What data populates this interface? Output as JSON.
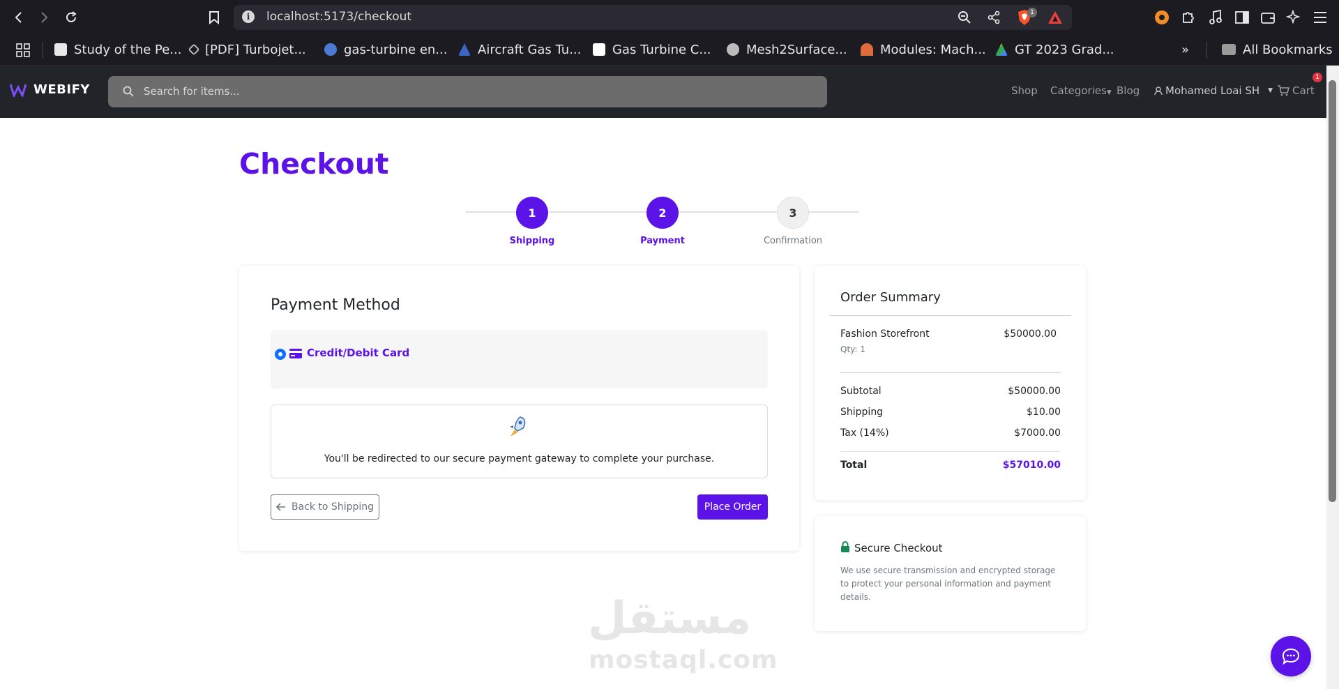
{
  "browser": {
    "url": "localhost:5173/checkout",
    "bookmarks": [
      {
        "label": "Study of the Pe..."
      },
      {
        "label": "[PDF] Turbojet..."
      },
      {
        "label": "gas-turbine en..."
      },
      {
        "label": "Aircraft Gas Tu..."
      },
      {
        "label": "Gas Turbine C..."
      },
      {
        "label": "Mesh2Surface..."
      },
      {
        "label": "Modules: Mach..."
      },
      {
        "label": "GT 2023 Grad..."
      }
    ],
    "bookmarks_more": "»",
    "all_bookmarks": "All Bookmarks",
    "shield_badge": "1"
  },
  "site": {
    "brand": "WEBIFY",
    "search_placeholder": "Search for items...",
    "nav": {
      "shop": "Shop",
      "categories": "Categories",
      "blog": "Blog",
      "user": "Mohamed Loai SH",
      "cart": "Cart",
      "cart_count": "1"
    }
  },
  "checkout": {
    "title": "Checkout",
    "steps": [
      {
        "number": "1",
        "label": "Shipping",
        "state": "complete"
      },
      {
        "number": "2",
        "label": "Payment",
        "state": "active"
      },
      {
        "number": "3",
        "label": "Confirmation",
        "state": "pending"
      }
    ],
    "payment": {
      "title": "Payment Method",
      "option_label": "Credit/Debit Card",
      "redirect_text": "You'll be redirected to our secure payment gateway to complete your purchase.",
      "back_label": "Back to Shipping",
      "place_label": "Place Order"
    },
    "summary": {
      "title": "Order Summary",
      "item_name": "Fashion Storefront",
      "item_qty": "Qty: 1",
      "item_price": "$50000.00",
      "subtotal_label": "Subtotal",
      "subtotal": "$50000.00",
      "shipping_label": "Shipping",
      "shipping": "$10.00",
      "tax_label": "Tax (14%)",
      "tax": "$7000.00",
      "total_label": "Total",
      "total": "$57010.00"
    },
    "secure": {
      "title": "Secure Checkout",
      "text": "We use secure transmission and encrypted storage to protect your personal information and payment details."
    }
  },
  "watermark": {
    "arabic": "مستقل",
    "latin": "mostaql.com"
  },
  "colors": {
    "accent": "#5b13e7",
    "navbar": "#212529",
    "browser_chrome": "#1c1b22"
  }
}
